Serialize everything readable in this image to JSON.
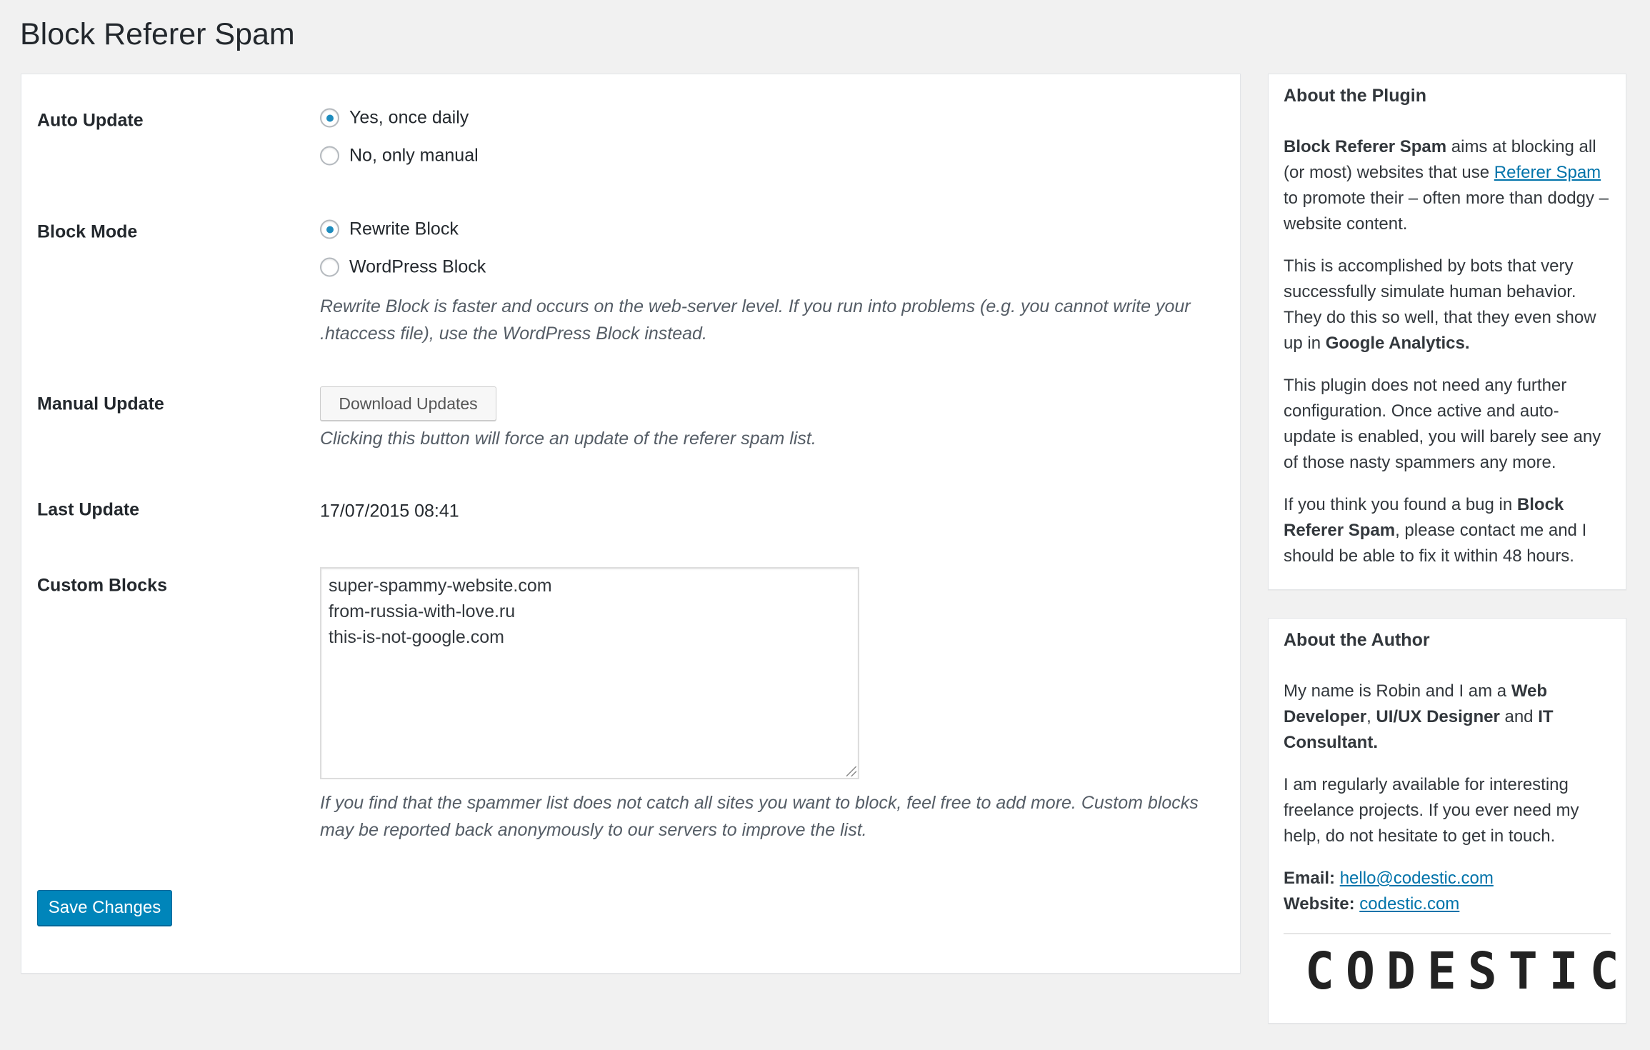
{
  "page": {
    "title": "Block Referer Spam"
  },
  "settings": {
    "auto_update": {
      "label": "Auto Update",
      "options": [
        {
          "label": "Yes, once daily",
          "checked": true
        },
        {
          "label": "No, only manual",
          "checked": false
        }
      ]
    },
    "block_mode": {
      "label": "Block Mode",
      "options": [
        {
          "label": "Rewrite Block",
          "checked": true
        },
        {
          "label": "WordPress Block",
          "checked": false
        }
      ],
      "description": [
        "Rewrite Block is faster and occurs on the web-server level. If you run into problems (e.g. you cannot write your",
        ".htaccess file), use the WordPress Block instead."
      ]
    },
    "manual_update": {
      "label": "Manual Update",
      "button": "Download Updates",
      "description": "Clicking this button will force an update of the referer spam list."
    },
    "last_update": {
      "label": "Last Update",
      "value": "17/07/2015 08:41"
    },
    "custom_blocks": {
      "label": "Custom Blocks",
      "lines": [
        "super-spammy-website.com",
        "from-russia-with-love.ru",
        "this-is-not-google.com"
      ],
      "description": [
        "If you find that the spammer list does not catch all sites you want to block, feel free to add more. Custom blocks",
        "may be reported back anonymously to our servers to improve the list."
      ]
    },
    "save_button": "Save Changes"
  },
  "about_plugin": {
    "title": "About the Plugin",
    "p1": {
      "b1": "Block Referer Spam",
      "t1": " aims at blocking all (or most) websites that use ",
      "link": "Referer Spam",
      "t2": " to promote their – often more than dodgy – website content."
    },
    "p2": {
      "t1": "This is accomplished by bots that very successfully simulate human behavior. They do this so well, that they even show up in ",
      "b1": "Google Analytics."
    },
    "p3": "This plugin does not need any further configuration. Once active and auto-update is enabled, you will barely see any of those nasty spammers any more.",
    "p4": {
      "t1": "If you think you found a bug in ",
      "b1": "Block Referer Spam",
      "t2": ", please contact me and I should be able to fix it within 48 hours."
    }
  },
  "about_author": {
    "title": "About the Author",
    "p1": {
      "t1": "My name is Robin and I am a ",
      "b1": "Web Developer",
      "t2": ", ",
      "b2": "UI/UX Designer",
      "t3": " and ",
      "b3": "IT Consultant."
    },
    "p2": "I am regularly available for interesting freelance projects. If you ever need my help, do not hesitate to get in touch.",
    "email_label": "Email:",
    "email": "hello@codestic.com",
    "website_label": "Website:",
    "website": "codestic.com",
    "logo_text": "CODESTIC"
  },
  "colors": {
    "accent": "#0085ba",
    "link": "#0073aa",
    "logo_red": "#d0202a"
  }
}
